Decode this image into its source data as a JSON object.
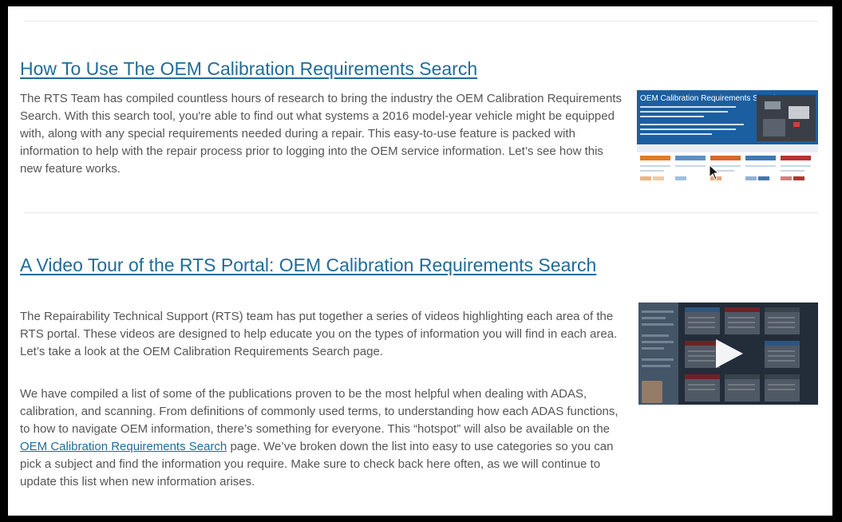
{
  "articles": [
    {
      "title": "How To Use The OEM Calibration Requirements Search",
      "body": "The RTS Team has compiled countless hours of research to bring the industry the OEM Calibration Requirements Search. With this search tool, you're able to find out what systems a 2016 model-year vehicle might be equipped with, along with any special requirements needed during a repair. This easy-to-use feature is packed with information to help with the repair process prior to logging into the OEM service information. Let’s see how this new feature works.",
      "thumbnail": {
        "title": "OEM Calibration Requirements Search"
      }
    },
    {
      "title": "A Video Tour of the RTS Portal: OEM Calibration Requirements Search",
      "paragraphs": {
        "p1": "The Repairability Technical Support (RTS) team has put together a series of videos highlighting each area of the RTS portal. These videos are designed to help educate you on the types of information you will find in each area. Let’s take a look at the OEM Calibration Requirements Search page.",
        "p2_before": "We have compiled a list of some of the publications proven to be the most helpful when dealing with ADAS, calibration, and scanning. From definitions of commonly used terms, to understanding how each ADAS functions, to how to navigate OEM information, there’s something for everyone. This “hotspot” will also be available on the ",
        "p2_link": "OEM Calibration Requirements Search",
        "p2_after": " page. We’ve broken down the list into easy to use categories so you can pick a subject and find the information you require. Make sure to check back here often, as we will continue to update this list when new information arises."
      }
    }
  ],
  "colors": {
    "link": "#1f6c9a",
    "body_text": "#555555",
    "thumbnail_banner": "#1b5fa0"
  },
  "icons": {
    "thumbnail1_pointer": "cursor-arrow-icon",
    "thumbnail2_play": "play-icon"
  }
}
